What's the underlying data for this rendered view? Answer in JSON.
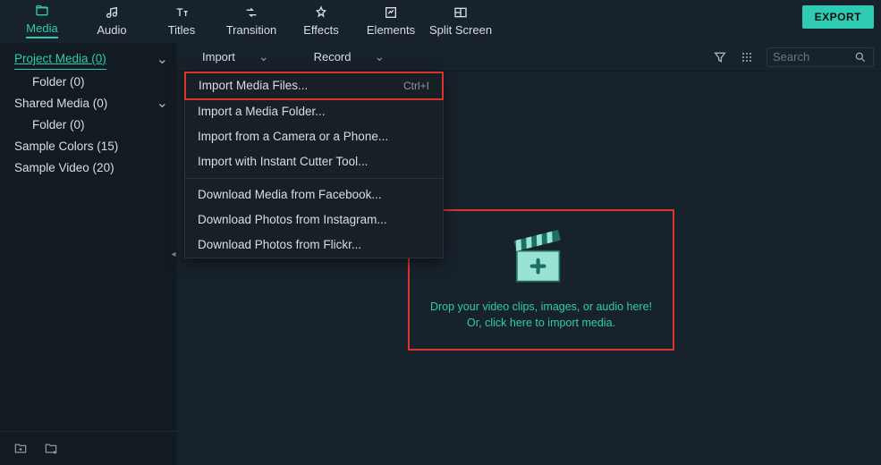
{
  "export_label": "EXPORT",
  "tabs": [
    {
      "label": "Media",
      "active": true
    },
    {
      "label": "Audio"
    },
    {
      "label": "Titles"
    },
    {
      "label": "Transition"
    },
    {
      "label": "Effects"
    },
    {
      "label": "Elements"
    },
    {
      "label": "Split Screen"
    }
  ],
  "sidebar": {
    "items": [
      {
        "label": "Project Media (0)",
        "selected": true,
        "chevron": true
      },
      {
        "label": "Folder (0)",
        "child": true
      },
      {
        "label": "Shared Media (0)",
        "chevron": true
      },
      {
        "label": "Folder (0)",
        "child": true
      },
      {
        "label": "Sample Colors (15)"
      },
      {
        "label": "Sample Video (20)"
      }
    ]
  },
  "toolbar": {
    "import_label": "Import",
    "record_label": "Record",
    "search_placeholder": "Search"
  },
  "import_menu": {
    "items": [
      {
        "label": "Import Media Files...",
        "shortcut": "Ctrl+I",
        "highlighted": true
      },
      {
        "label": "Import a Media Folder..."
      },
      {
        "label": "Import from a Camera or a Phone..."
      },
      {
        "label": "Import with Instant Cutter Tool..."
      }
    ],
    "items2": [
      {
        "label": "Download Media from Facebook..."
      },
      {
        "label": "Download Photos from Instagram..."
      },
      {
        "label": "Download Photos from Flickr..."
      }
    ]
  },
  "dropzone": {
    "line1": "Drop your video clips, images, or audio here!",
    "line2": "Or, click here to import media."
  }
}
